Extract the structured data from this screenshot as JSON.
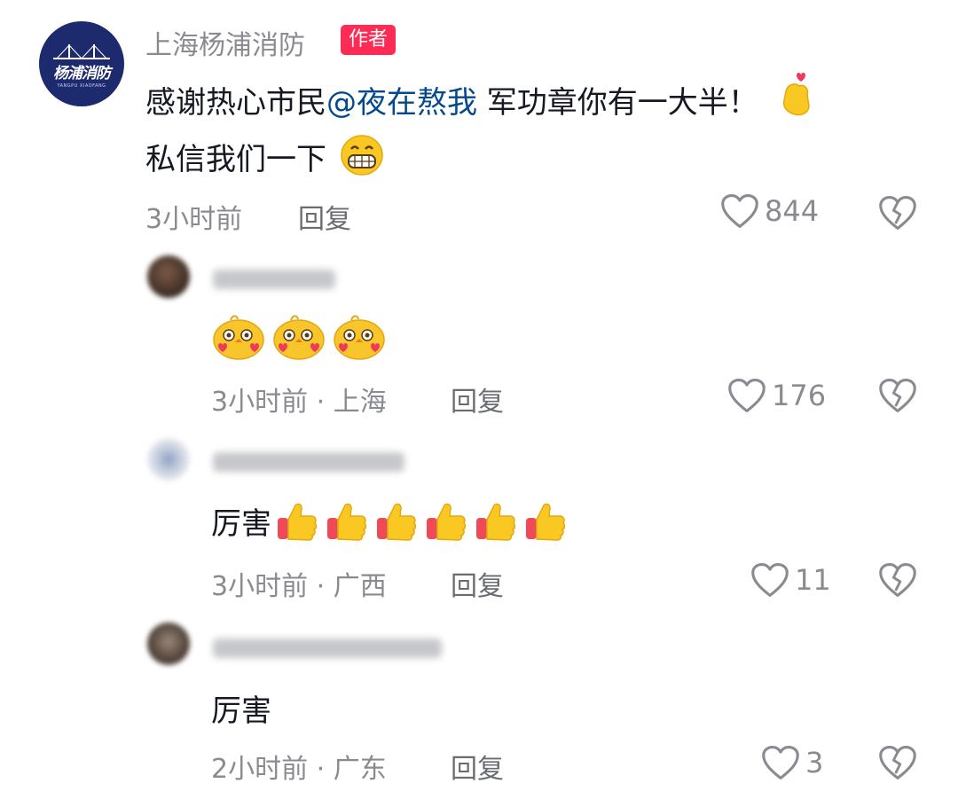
{
  "author_comment": {
    "name": "上海杨浦消防",
    "badge": "作者",
    "avatar_text": "杨浦消防",
    "avatar_subtext": "YANGPU XIAOFANG",
    "text_before": "感谢热心市民",
    "mention": "@夜在熬我",
    "text_after": " 军功章你有一大半！",
    "text_line2": "私信我们一下",
    "time": "3小时前",
    "reply_label": "回复",
    "likes": "844",
    "icons": [
      "finger-heart-icon",
      "grin-emoji-icon",
      "heart-outline-icon",
      "broken-heart-icon"
    ]
  },
  "replies": [
    {
      "emoji": "chick-love-emoji",
      "emoji_count": 3,
      "text": "",
      "time_location": "3小时前 · 上海",
      "reply_label": "回复",
      "likes": "176"
    },
    {
      "text": "厉害",
      "emoji": "thumbs-up-emoji",
      "emoji_count": 6,
      "time_location": "3小时前 · 广西",
      "reply_label": "回复",
      "likes": "11"
    },
    {
      "text": "厉害",
      "time_location": "2小时前 · 广东",
      "reply_label": "回复",
      "likes": "3"
    }
  ],
  "colors": {
    "badge": "#fe2c55",
    "mention": "#04498d",
    "meta": "#8a8b91",
    "avatar_bg": "#1e2a6e"
  }
}
